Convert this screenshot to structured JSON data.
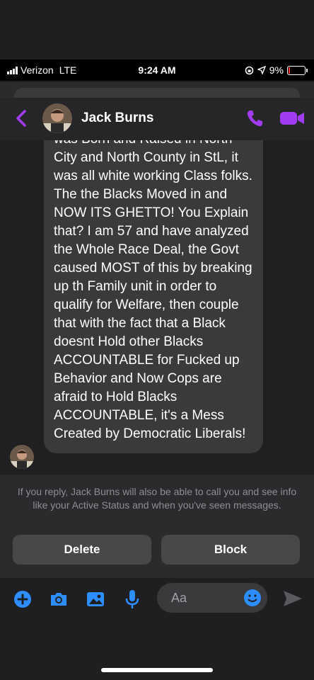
{
  "status_bar": {
    "carrier": "Verizon",
    "network": "LTE",
    "time": "9:24 AM",
    "battery": "9%"
  },
  "header": {
    "contact_name": "Jack Burns"
  },
  "message": {
    "text": "was Born and Raised in North City and North County in StL, it was all white working Class folks. The the Blacks Moved in and NOW ITS GHETTO! You Explain that? I am 57 and have analyzed the Whole Race Deal, the Govt caused MOST of this by breaking up th Family unit in order to qualify for Welfare, then couple that with the fact that a Black doesnt Hold other Blacks ACCOUNTABLE for Fucked up Behavior and Now Cops are afraid to Hold Blacks ACCOUNTABLE, it's a Mess Created by Democratic Liberals!"
  },
  "notice": {
    "text": "If you reply, Jack Burns will also be able to call you and see info like your Active Status and when you've seen messages."
  },
  "actions": {
    "delete_label": "Delete",
    "block_label": "Block"
  },
  "composer": {
    "placeholder": "Aa"
  },
  "colors": {
    "accent_purple": "#a23cf2",
    "accent_blue": "#2d8cff",
    "bubble": "#3a3a3c",
    "button": "#48484a"
  },
  "icons": [
    "chevron-left-icon",
    "phone-icon",
    "video-icon",
    "plus-icon",
    "camera-icon",
    "image-icon",
    "microphone-icon",
    "emoji-icon",
    "send-icon"
  ]
}
